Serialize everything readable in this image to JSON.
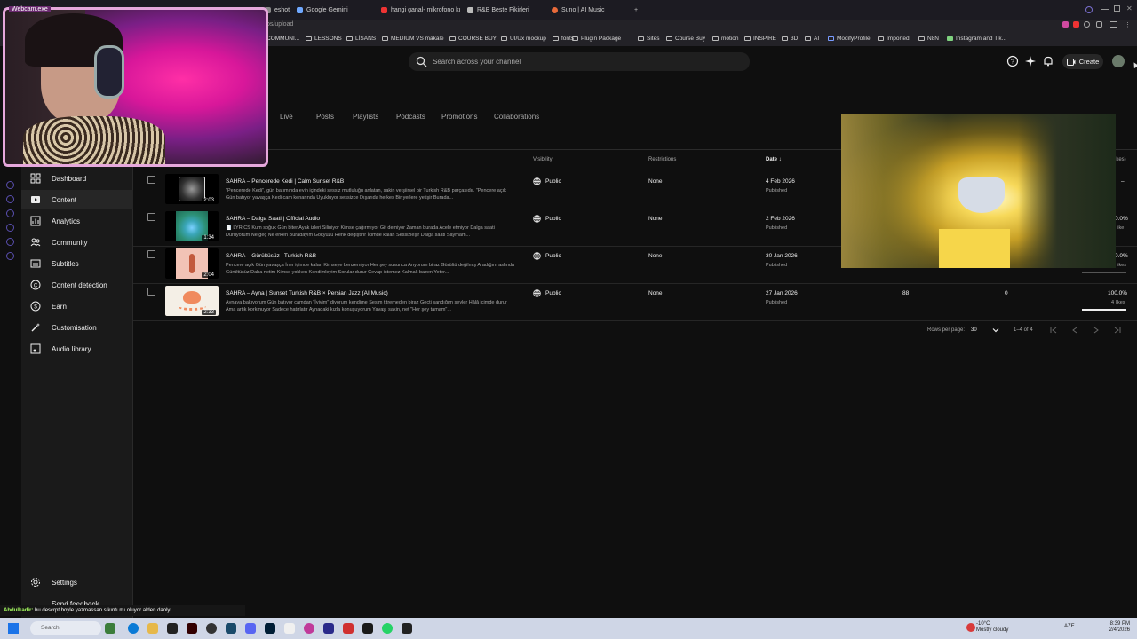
{
  "browser": {
    "tabs": [
      {
        "label": "eshot",
        "color": "#888888"
      },
      {
        "label": "Google Gemini",
        "color": "#6fa8ff"
      },
      {
        "label": "hangi ganal- mikrofono kı",
        "color": "#e33"
      },
      {
        "label": "R&B Beste Fikirleri",
        "color": "#bbbbbb"
      },
      {
        "label": "Suno | AI Music",
        "color": "#e86a3a"
      }
    ],
    "new_tab": "+",
    "url": "os/upload",
    "bookmarks": [
      "COMMUNI...",
      "LESSONS",
      "LİSANS",
      "MEDIUM VS makale",
      "COURSE BUY",
      "UI/Ux mockup",
      "fonts",
      "Plugin Package",
      "Sites",
      "Course Buy",
      "motion",
      "INSPIRE",
      "3D",
      "AI",
      "ModifyProfile",
      "Imported",
      "N8N",
      "Instagram and Tik..."
    ]
  },
  "header": {
    "search_placeholder": "Search across your channel",
    "create_label": "Create"
  },
  "webcam": {
    "label": "Webcam.exe"
  },
  "sidebar": {
    "items": [
      {
        "label": "Dashboard",
        "icon": "dashboard-icon"
      },
      {
        "label": "Content",
        "icon": "content-icon",
        "active": true
      },
      {
        "label": "Analytics",
        "icon": "analytics-icon"
      },
      {
        "label": "Community",
        "icon": "community-icon"
      },
      {
        "label": "Subtitles",
        "icon": "subtitles-icon"
      },
      {
        "label": "Content detection",
        "icon": "copyright-icon"
      },
      {
        "label": "Earn",
        "icon": "dollar-icon"
      },
      {
        "label": "Customisation",
        "icon": "wand-icon"
      },
      {
        "label": "Audio library",
        "icon": "audio-library-icon"
      }
    ],
    "settings": "Settings",
    "feedback": "Send feedback"
  },
  "content_tabs": [
    "Live",
    "Posts",
    "Playlists",
    "Podcasts",
    "Promotions",
    "Collaborations"
  ],
  "columns": {
    "visibility": "Visibility",
    "restrictions": "Restrictions",
    "date": "Date",
    "likes": "ikes)"
  },
  "videos": [
    {
      "title": "SAHRA – Pencerede Kedi | Calm Sunset R&B",
      "desc": "\"Pencerede Kedi\", gün batımında evin içindeki sessiz mutluluğu anlatan, sakin ve şiirsel bir Turkish R&B parçasıdır. \"Pencere açık Gün batıyor yavaşça Kedi cam kenarında Uyukluyor sessizce Dışarıda herkes Bir yerlere yetişir Burada...",
      "duration": "2:03",
      "visibility": "Public",
      "restrictions": "None",
      "date": "4 Feb 2026",
      "status": "Published",
      "views": "",
      "comments": "",
      "likes_pct": "–",
      "likes_count": "",
      "likes_ratio": 0,
      "thumb": "#1a1a1a"
    },
    {
      "title": "SAHRA – Dalga Saati | Official Audio",
      "desc": "📄 LYRICS Kum soğuk Gün biter Ayak izleri Siliniyor Kimse çağırmıyor Git demiyor Zaman burada Acele etmiyor Dalga saati Duruyorum Ne geç Ne erken Buradayım Gökyüzü Renk değiştirir İçimde kalan Sessizleşir Dalga saati Saymam...",
      "duration": "1:34",
      "visibility": "Public",
      "restrictions": "None",
      "date": "2 Feb 2026",
      "status": "Published",
      "views": "",
      "comments": "",
      "likes_pct": "0.0%",
      "likes_count": "like",
      "likes_ratio": 0,
      "thumb": "#2c8f74"
    },
    {
      "title": "SAHRA – Gürültüsüz | Turkish R&B",
      "desc": "Pencere açık Gün yavaşça İner içimde kalan Kimseye benzemiyor Her şey susunca Arıyorum biraz Gürültü değilmiş Aradığım aslında Gürültüsüz Daha netim Kimse yokken Kendimleyim Sorular durur Cevap istemez Kalmak bazen Yeter...",
      "duration": "2:04",
      "visibility": "Public",
      "restrictions": "None",
      "date": "30 Jan 2026",
      "status": "Published",
      "views": "",
      "comments": "",
      "likes_pct": "0.0%",
      "likes_count": "likes",
      "likes_ratio": 0,
      "thumb": "#f2c3b6"
    },
    {
      "title": "SAHRA – Ayna | Sunset Turkish R&B × Persian Jazz (AI Music)",
      "desc": "Aynaya bakıyorum Gün batıyor camdan \"İyiyim\" diyorum kendime Sesim titremeden biraz Geçti sandığım şeyler Hâlâ içimde durur Ama artık korkmuyor Sadece hatırlatır Aynadaki kızla konuşuyorum Yavaş, sakin, net \"Her şey tamam\"...",
      "duration": "2:33",
      "visibility": "Public",
      "restrictions": "None",
      "date": "27 Jan 2026",
      "status": "Published",
      "views": "88",
      "comments": "0",
      "likes_pct": "100.0%",
      "likes_count": "4 likes",
      "likes_ratio": 1,
      "thumb": "#f4efe6"
    }
  ],
  "pagination": {
    "rows_label": "Rows per page:",
    "rows_value": "30",
    "range": "1–4 of 4"
  },
  "chat": {
    "user": "Abdulkadir:",
    "message": "bu descrpt boyle yazmassan sıkıntı mı oluyor alden daolyı"
  },
  "taskbar": {
    "search": "Search",
    "weather_temp": "-10°C",
    "weather_desc": "Mostly cloudy",
    "lang": "AZE",
    "time": "8:39 PM",
    "date": "2/4/2026"
  }
}
